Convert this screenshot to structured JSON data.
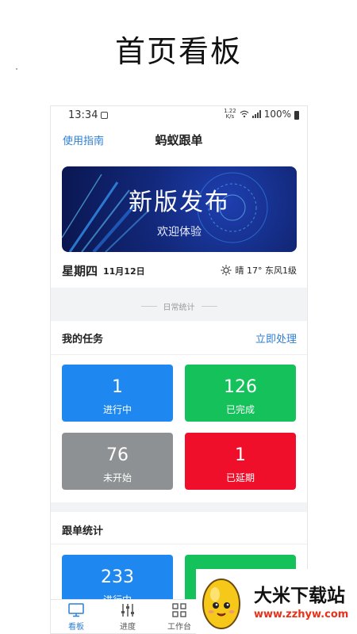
{
  "page": {
    "heading": "首页看板"
  },
  "statusbar": {
    "time": "13:34",
    "speed_top": "1.22",
    "speed_unit": "K/s",
    "battery": "100%"
  },
  "navbar": {
    "left_link": "使用指南",
    "title": "蚂蚁跟单"
  },
  "banner": {
    "title": "新版发布",
    "subtitle": "欢迎体验"
  },
  "date": {
    "weekday": "星期四",
    "date": "11月12日",
    "weather": "晴 17° 东风1级"
  },
  "section_divider": "日常统计",
  "tasks": {
    "title": "我的任务",
    "action": "立即处理",
    "tiles": [
      {
        "value": "1",
        "label": "进行中",
        "color": "#1f88f0"
      },
      {
        "value": "126",
        "label": "已完成",
        "color": "#14c15b"
      },
      {
        "value": "76",
        "label": "未开始",
        "color": "#8e9193"
      },
      {
        "value": "1",
        "label": "已延期",
        "color": "#ef0f2a"
      }
    ]
  },
  "stats": {
    "title": "跟单统计",
    "tiles": [
      {
        "value": "233",
        "label": "进行中",
        "color": "#1f88f0"
      }
    ]
  },
  "tabbar": {
    "tabs": [
      {
        "label": "看板",
        "icon": "monitor-icon",
        "active": true
      },
      {
        "label": "进度",
        "icon": "sliders-icon",
        "active": false
      },
      {
        "label": "工作台",
        "icon": "grid-icon",
        "active": false
      }
    ]
  },
  "watermark": {
    "name": "大米下载站",
    "url": "www.zzhyw.com"
  },
  "colors": {
    "accent": "#2d7fd6",
    "banner_dark": "#0a1650"
  }
}
